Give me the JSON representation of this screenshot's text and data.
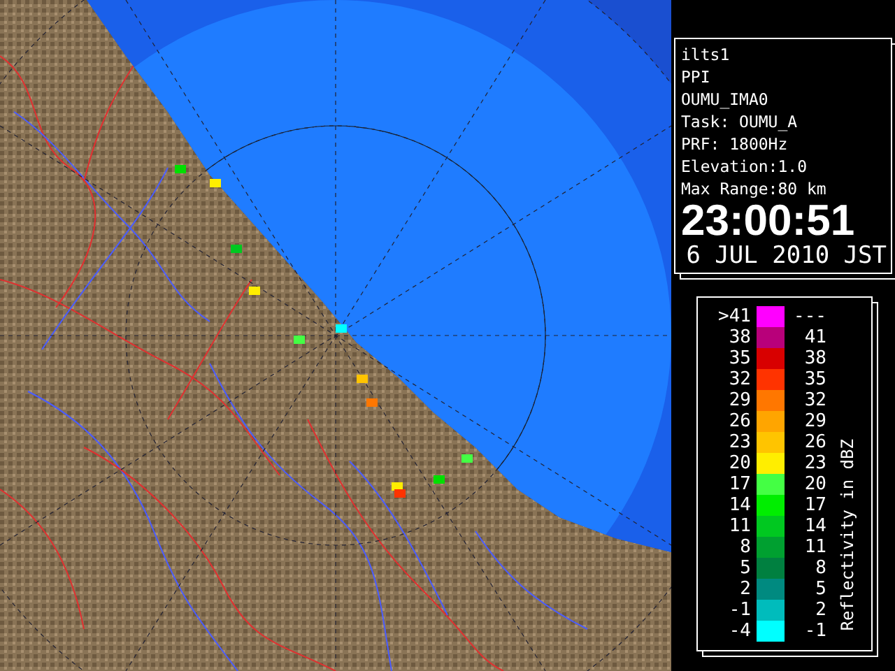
{
  "info_panel": {
    "lines": [
      "ilts1",
      "PPI",
      "OUMU_IMA0",
      "Task: OUMU_A",
      "PRF: 1800Hz",
      "Elevation:1.0",
      "Max Range:80 km"
    ],
    "time": "23:00:51",
    "date": "6 JUL 2010 JST"
  },
  "legend": {
    "title": "Reflectivity in dBZ",
    "rows": [
      {
        "low": ">41",
        "high": "---",
        "color": "#ff00ff"
      },
      {
        "low": "38",
        "high": "41",
        "color": "#b8007a"
      },
      {
        "low": "35",
        "high": "38",
        "color": "#d80000"
      },
      {
        "low": "32",
        "high": "35",
        "color": "#ff3300"
      },
      {
        "low": "29",
        "high": "32",
        "color": "#ff7700"
      },
      {
        "low": "26",
        "high": "29",
        "color": "#ffa500"
      },
      {
        "low": "23",
        "high": "26",
        "color": "#ffc400"
      },
      {
        "low": "20",
        "high": "23",
        "color": "#ffee00"
      },
      {
        "low": "17",
        "high": "20",
        "color": "#44ff44"
      },
      {
        "low": "14",
        "high": "17",
        "color": "#00ee00"
      },
      {
        "low": "11",
        "high": "14",
        "color": "#00c820"
      },
      {
        "low": "8",
        "high": "11",
        "color": "#00a030"
      },
      {
        "low": "5",
        "high": "8",
        "color": "#008040"
      },
      {
        "low": "2",
        "high": "5",
        "color": "#008a80"
      },
      {
        "low": "-1",
        "high": "2",
        "color": "#00bcbc"
      },
      {
        "low": "-4",
        "high": "-1",
        "color": "#00ffff"
      }
    ]
  }
}
